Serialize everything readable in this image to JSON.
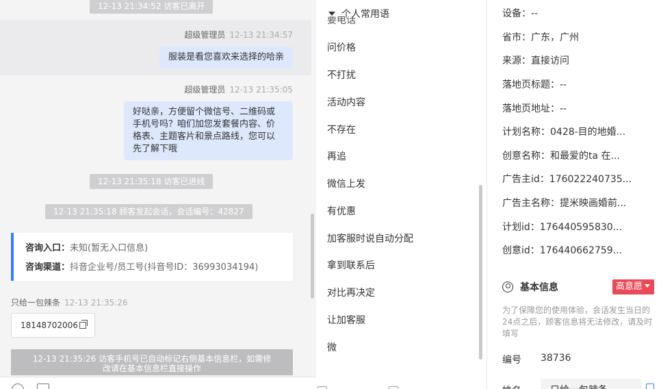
{
  "chat": {
    "sys_left": "12-13 21:34:52 访客已离开",
    "msg1_sender": "超级管理员",
    "msg1_time": "12-13 21:34:57",
    "msg1_text": "服装是看您喜欢来选择的哈亲",
    "msg2_sender": "超级管理员",
    "msg2_time": "12-13 21:35:05",
    "msg2_lines": [
      "好哒亲，方便留个微信号、二维码或",
      "手机号吗？咱们加您发套餐内容、价",
      "格表、主题客片和景点路线，您可以",
      "先了解下哦"
    ],
    "sys_enter": "12-13 21:35:18 访客已进线",
    "sys_session": "12-13 21:35:18 顾客发起会话，会话编号：42827",
    "card_entry_label": "咨询入口：",
    "card_entry_value": "未知(暂无入口信息)",
    "card_channel_label": "咨询渠道：",
    "card_channel_value": "抖音企业号/员工号(抖音号ID：36993034194)",
    "visitor_name": "只给一包辣条",
    "visitor_time": "12-13 21:35:26",
    "visitor_phone": "18148702006",
    "sys_phone_lines": [
      "12-13 21:35:26 访客手机号已自动标记右侧基本信息栏，如需修",
      "改请在基本信息栏直接操作"
    ]
  },
  "phrases": {
    "header": "个人常用语",
    "cut_item": "要电话",
    "items": [
      "问价格",
      "不打扰",
      "活动内容",
      "不存在",
      "再追",
      "微信上发",
      "有优惠",
      "加客服时说自动分配",
      "拿到联系后",
      "对比再决定",
      "让加客服",
      "微"
    ]
  },
  "info": {
    "rows": [
      {
        "label": "设备：",
        "value": "--"
      },
      {
        "label": "省市：",
        "value": "广东，广州"
      },
      {
        "label": "来源：",
        "value": "直接访问"
      },
      {
        "label": "落地页标题：",
        "value": "--"
      },
      {
        "label": "落地页地址：",
        "value": "--"
      },
      {
        "label": "计划名称：",
        "value": "0428-目的地婚..."
      },
      {
        "label": "创意名称：",
        "value": "和最爱的ta 在..."
      },
      {
        "label": "广告主id：",
        "value": "176022240735..."
      },
      {
        "label": "广告主名称：",
        "value": "提米映画婚前..."
      },
      {
        "label": "计划id：",
        "value": "176440595830..."
      },
      {
        "label": "创意id：",
        "value": "176440662759..."
      }
    ],
    "section_title": "基本信息",
    "intent_badge": "高意愿",
    "note": "为了保障您的使用体验，会话发生当日的24点之后，顾客信息将无法修改，请及时填写",
    "id_label": "编号",
    "id_value": "38736",
    "name_label": "姓名",
    "name_value": "只给一包辣条"
  },
  "colors": {
    "accent": "#3b7cf6",
    "badge": "#e84b57",
    "bubble": "#dde8fd"
  }
}
